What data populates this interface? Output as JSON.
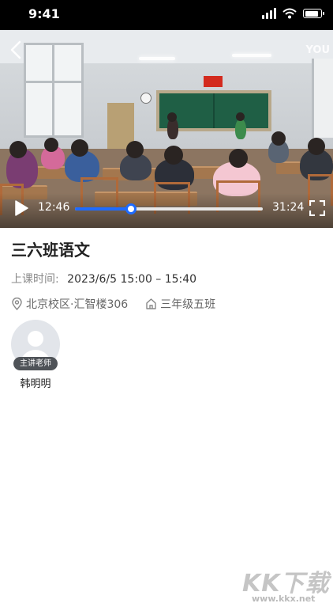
{
  "status_bar": {
    "time": "9:41"
  },
  "player": {
    "watermark": "YOU",
    "current_time": "12:46",
    "total_time": "31:24",
    "progress": 0.3
  },
  "lesson": {
    "title": "三六班语文",
    "time_label": "上课时间:",
    "time_value": "2023/6/5  15:00 – 15:40",
    "location": "北京校区·汇智楼306",
    "class_name": "三年级五班"
  },
  "teacher": {
    "role": "主讲老师",
    "name": "韩明明"
  },
  "site_logo": {
    "mark": "KK下载",
    "url": "www.kkx.net"
  },
  "colors": {
    "accent": "#1e6bff",
    "status_bar": "#000000"
  },
  "icons": [
    "back-icon",
    "play-icon",
    "fullscreen-icon",
    "location-pin-icon",
    "home-icon"
  ]
}
